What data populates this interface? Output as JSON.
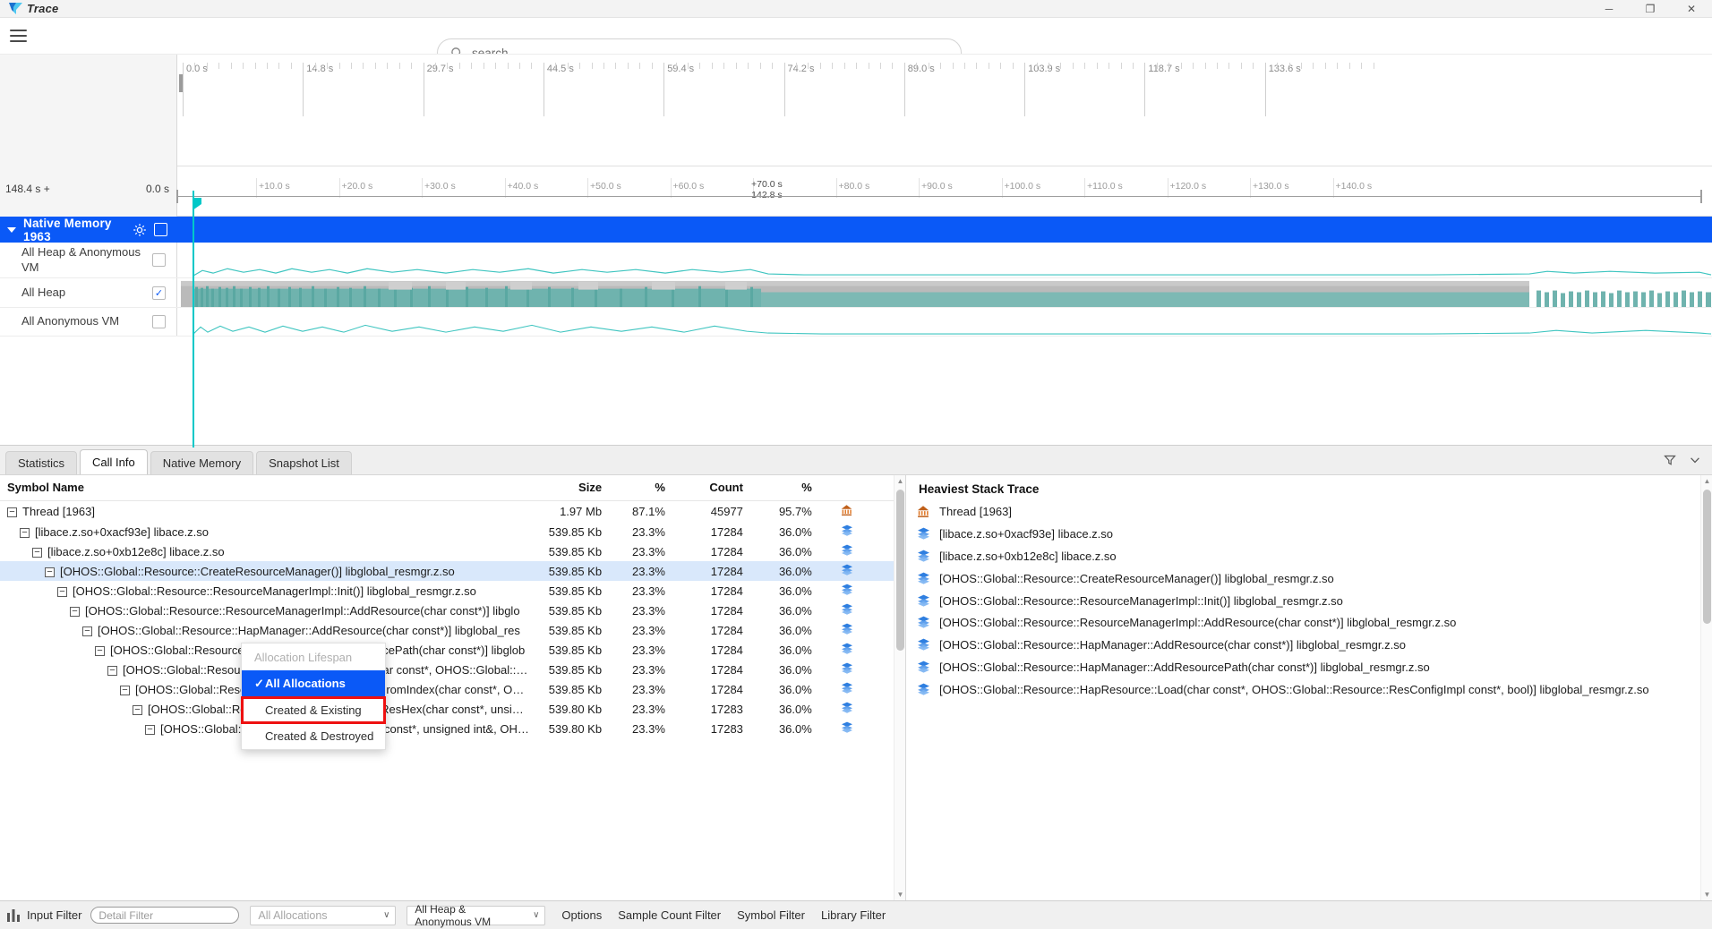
{
  "titlebar": {
    "app_name": "Trace",
    "logo_icon": "trace-logo-icon",
    "minimize": "─",
    "maximize": "❐",
    "close": "✕"
  },
  "search": {
    "placeholder": "search",
    "icon": "search-icon"
  },
  "ruler": {
    "major_ticks": [
      "0.0 s",
      "14.8 s",
      "29.7 s",
      "44.5 s",
      "59.4 s",
      "74.2 s",
      "89.0 s",
      "103.9 s",
      "118.7 s",
      "133.6 s"
    ]
  },
  "subruler": {
    "left_label": "148.4 s +",
    "right_label": "0.0 s",
    "center_label": "+70.0 s",
    "center_sub": "142.8 s",
    "ticks": [
      "+10.0 s",
      "+20.0 s",
      "+30.0 s",
      "+40.0 s",
      "+50.0 s",
      "+60.0 s",
      "+70.0 s",
      "+80.0 s",
      "+90.0 s",
      "+100.0 s",
      "+110.0 s",
      "+120.0 s",
      "+130.0 s",
      "+140.0 s"
    ]
  },
  "tracks": {
    "group": {
      "label": "Native Memory 1963",
      "gear_icon": "gear-icon",
      "collapse_icon": "chevron-down-icon",
      "checked": false
    },
    "children": [
      {
        "label": "All Heap & Anonymous VM",
        "checked": false
      },
      {
        "label": "All Heap",
        "checked": true
      },
      {
        "label": "All Anonymous VM",
        "checked": false
      }
    ]
  },
  "tabs": [
    {
      "label": "Statistics",
      "active": false
    },
    {
      "label": "Call Info",
      "active": true
    },
    {
      "label": "Native Memory",
      "active": false
    },
    {
      "label": "Snapshot List",
      "active": false
    }
  ],
  "tab_tools": {
    "filter_icon": "funnel-icon",
    "expand_icon": "chevron-down-icon"
  },
  "table": {
    "columns": [
      "Symbol Name",
      "Size",
      "%",
      "Count",
      "%",
      ""
    ],
    "rows": [
      {
        "indent": 0,
        "expander": "−",
        "symbol": "Thread [1963]",
        "size": "1.97 Mb",
        "pct1": "87.1%",
        "count": "45977",
        "pct2": "95.7%",
        "icon": "flame-icon",
        "selected": false
      },
      {
        "indent": 1,
        "expander": "−",
        "symbol": "[libace.z.so+0xacf93e] libace.z.so",
        "size": "539.85 Kb",
        "pct1": "23.3%",
        "count": "17284",
        "pct2": "36.0%",
        "icon": "stack-icon",
        "selected": false
      },
      {
        "indent": 2,
        "expander": "−",
        "symbol": "[libace.z.so+0xb12e8c] libace.z.so",
        "size": "539.85 Kb",
        "pct1": "23.3%",
        "count": "17284",
        "pct2": "36.0%",
        "icon": "stack-icon",
        "selected": false
      },
      {
        "indent": 3,
        "expander": "−",
        "symbol": "[OHOS::Global::Resource::CreateResourceManager()] libglobal_resmgr.z.so",
        "size": "539.85 Kb",
        "pct1": "23.3%",
        "count": "17284",
        "pct2": "36.0%",
        "icon": "stack-icon",
        "selected": true
      },
      {
        "indent": 4,
        "expander": "−",
        "symbol": "[OHOS::Global::Resource::ResourceManagerImpl::Init()] libglobal_resmgr.z.so",
        "size": "539.85 Kb",
        "pct1": "23.3%",
        "count": "17284",
        "pct2": "36.0%",
        "icon": "stack-icon",
        "selected": false
      },
      {
        "indent": 5,
        "expander": "−",
        "symbol": "[OHOS::Global::Resource::ResourceManagerImpl::AddResource(char const*)] libglo",
        "size": "539.85 Kb",
        "pct1": "23.3%",
        "count": "17284",
        "pct2": "36.0%",
        "icon": "stack-icon",
        "selected": false
      },
      {
        "indent": 6,
        "expander": "−",
        "symbol": "[OHOS::Global::Resource::HapManager::AddResource(char const*)] libglobal_res",
        "size": "539.85 Kb",
        "pct1": "23.3%",
        "count": "17284",
        "pct2": "36.0%",
        "icon": "stack-icon",
        "selected": false
      },
      {
        "indent": 7,
        "expander": "−",
        "symbol": "[OHOS::Global::Resource::HapManager::AddResourcePath(char const*)] libglob",
        "size": "539.85 Kb",
        "pct1": "23.3%",
        "count": "17284",
        "pct2": "36.0%",
        "icon": "stack-icon",
        "selected": false
      },
      {
        "indent": 8,
        "expander": "−",
        "symbol": "[OHOS::Global::Resource::HapResource::Load(char const*, OHOS::Global::Res",
        "size": "539.85 Kb",
        "pct1": "23.3%",
        "count": "17284",
        "pct2": "36.0%",
        "icon": "stack-icon",
        "selected": false
      },
      {
        "indent": 9,
        "expander": "−",
        "symbol": "[OHOS::Global::Resource::HapResource::LoadFromIndex(char const*, OHO",
        "size": "539.85 Kb",
        "pct1": "23.3%",
        "count": "17284",
        "pct2": "36.0%",
        "icon": "stack-icon",
        "selected": false
      },
      {
        "indent": 10,
        "expander": "−",
        "symbol": "[OHOS::Global::Resource::HapParser::ParseResHex(char const*, unsigned",
        "size": "539.80 Kb",
        "pct1": "23.3%",
        "count": "17283",
        "pct2": "36.0%",
        "icon": "stack-icon",
        "selected": false
      },
      {
        "indent": 11,
        "expander": "−",
        "symbol": "[OHOS::Global::Resource::ResDesc::(char const*, unsigned int&, OHOS:",
        "size": "539.80 Kb",
        "pct1": "23.3%",
        "count": "17283",
        "pct2": "36.0%",
        "icon": "stack-icon",
        "selected": false
      }
    ]
  },
  "heaviest": {
    "title": "Heaviest Stack Trace",
    "rows": [
      {
        "icon": "flame-icon",
        "text": "Thread [1963]"
      },
      {
        "icon": "stack-icon",
        "text": "[libace.z.so+0xacf93e] libace.z.so"
      },
      {
        "icon": "stack-icon",
        "text": "[libace.z.so+0xb12e8c] libace.z.so"
      },
      {
        "icon": "stack-icon",
        "text": "[OHOS::Global::Resource::CreateResourceManager()] libglobal_resmgr.z.so"
      },
      {
        "icon": "stack-icon",
        "text": "[OHOS::Global::Resource::ResourceManagerImpl::Init()] libglobal_resmgr.z.so"
      },
      {
        "icon": "stack-icon",
        "text": "[OHOS::Global::Resource::ResourceManagerImpl::AddResource(char const*)] libglobal_resmgr.z.so"
      },
      {
        "icon": "stack-icon",
        "text": "[OHOS::Global::Resource::HapManager::AddResource(char const*)] libglobal_resmgr.z.so"
      },
      {
        "icon": "stack-icon",
        "text": "[OHOS::Global::Resource::HapManager::AddResourcePath(char const*)] libglobal_resmgr.z.so"
      },
      {
        "icon": "stack-icon",
        "text": "[OHOS::Global::Resource::HapResource::Load(char const*, OHOS::Global::Resource::ResConfigImpl const*, bool)] libglobal_resmgr.z.so"
      }
    ]
  },
  "dropdown": {
    "header": "Allocation Lifespan",
    "items": [
      {
        "label": "All Allocations",
        "selected": true,
        "highlighted": false,
        "check": "✓"
      },
      {
        "label": "Created & Existing",
        "selected": false,
        "highlighted": true,
        "check": ""
      },
      {
        "label": "Created & Destroyed",
        "selected": false,
        "highlighted": false,
        "check": ""
      }
    ]
  },
  "toolbar": {
    "input_filter_icon": "bar-chart-icon",
    "input_filter_label": "Input Filter",
    "detail_filter_placeholder": "Detail Filter",
    "allocation_combo_value": "All Allocations",
    "heap_combo_value": "All Heap & Anonymous VM",
    "options_label": "Options",
    "sample_count_filter_label": "Sample Count Filter",
    "symbol_filter_label": "Symbol Filter",
    "library_filter_label": "Library Filter",
    "chevron": "∨"
  },
  "colors": {
    "accent_blue": "#0a59f7",
    "playhead_cyan": "#00c8c8",
    "chart_teal": "#6fb3ae",
    "highlight_red": "#ee1111",
    "row_selected": "#d9e8fb"
  }
}
